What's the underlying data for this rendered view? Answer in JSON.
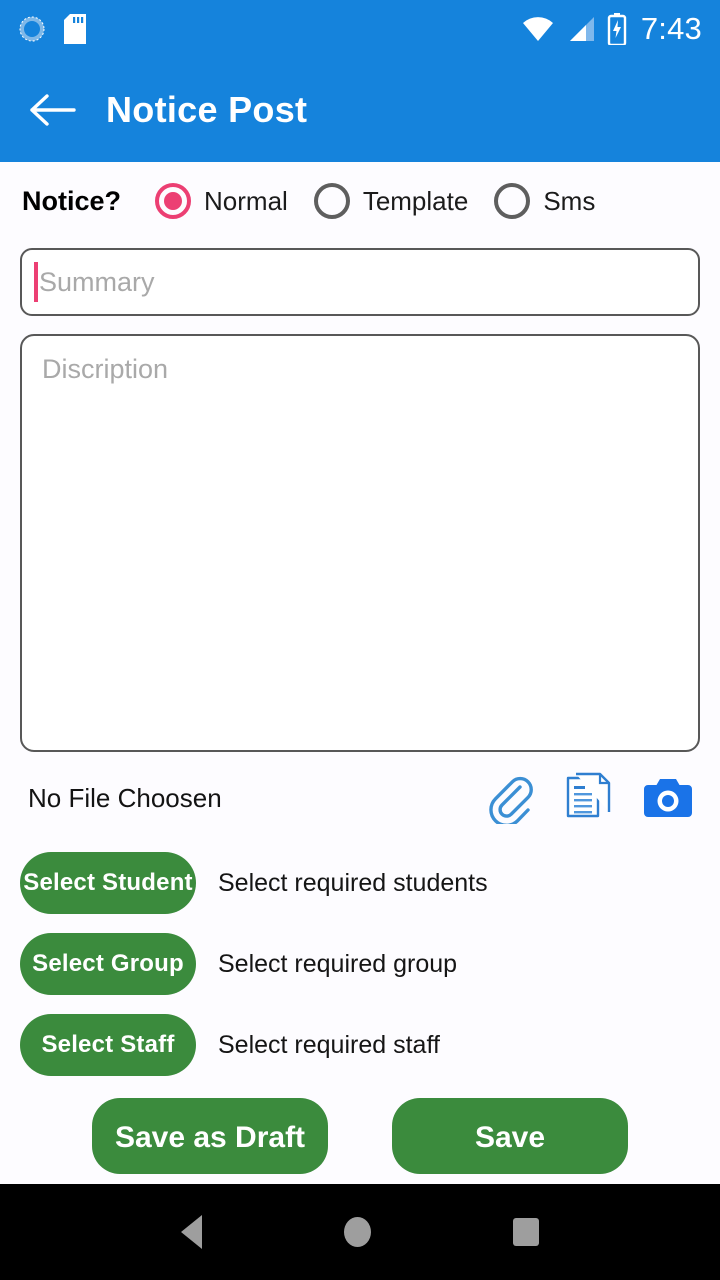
{
  "status_bar": {
    "time": "7:43",
    "icons": [
      "sync-icon",
      "sd-card-icon",
      "wifi-icon",
      "cellular-signal-icon",
      "battery-charging-icon"
    ]
  },
  "app_bar": {
    "back_icon": "back-arrow-icon",
    "title": "Notice Post"
  },
  "notice_type": {
    "label": "Notice?",
    "options": [
      {
        "label": "Normal",
        "selected": true
      },
      {
        "label": "Template",
        "selected": false
      },
      {
        "label": "Sms",
        "selected": false
      }
    ],
    "accent_color": "#ec3f73",
    "inactive_color": "#5e5e5e"
  },
  "summary_field": {
    "placeholder": "Summary",
    "value": "",
    "focused": true
  },
  "description_field": {
    "placeholder": "Discription",
    "value": ""
  },
  "attachment": {
    "status_text": "No File Choosen",
    "actions": [
      {
        "icon": "paperclip-icon",
        "color": "#3b8fd4"
      },
      {
        "icon": "document-icon",
        "color": "#2f7fd0"
      },
      {
        "icon": "camera-icon",
        "color": "#1a73e8"
      }
    ]
  },
  "selectors": [
    {
      "button_label": "Select Student",
      "hint": "Select required students"
    },
    {
      "button_label": "Select Group",
      "hint": "Select required group"
    },
    {
      "button_label": "Select Staff",
      "hint": "Select required staff"
    }
  ],
  "actions": {
    "draft_label": "Save as Draft",
    "save_label": "Save",
    "button_color": "#3b8b3d"
  },
  "nav_bar": {
    "back": "nav-back-icon",
    "home": "nav-home-icon",
    "recents": "nav-recents-icon"
  },
  "theme": {
    "primary": "#1583dc",
    "background": "#fdfcff",
    "border": "#585858",
    "placeholder": "#a9a9a9"
  }
}
